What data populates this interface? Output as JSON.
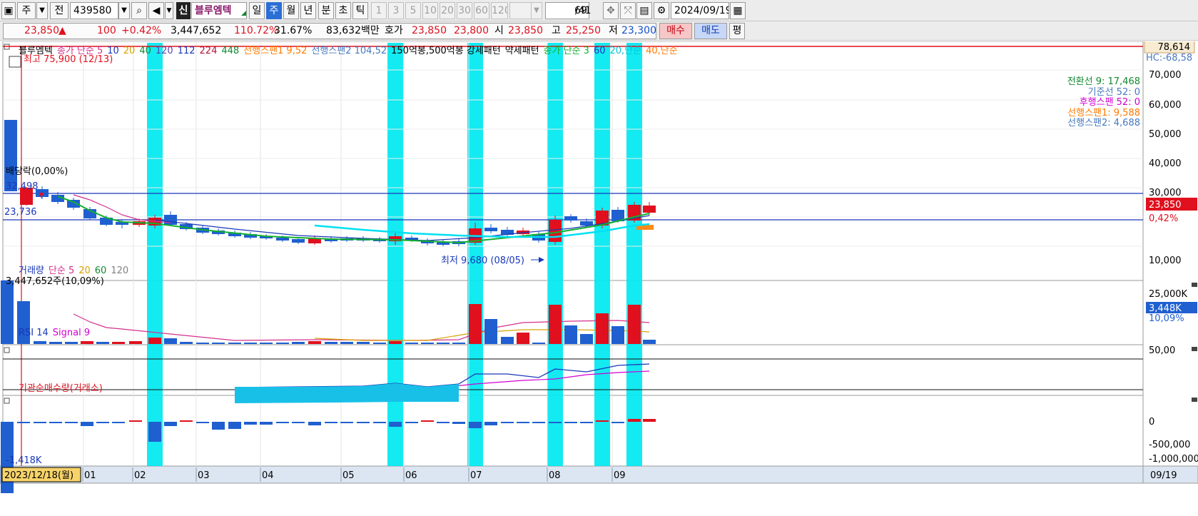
{
  "toolbar": {
    "period_unit": "주",
    "prev_label": "전",
    "code": "439580",
    "badge": "신",
    "stock_name": "블루엠텍",
    "periods": [
      "일",
      "주",
      "월",
      "년",
      "분",
      "초",
      "틱"
    ],
    "selected_period": "주",
    "intervals": [
      "1",
      "3",
      "5",
      "10",
      "20",
      "30",
      "60",
      "120"
    ],
    "count": "69",
    "count_total": "/41",
    "date": "2024/09/19"
  },
  "quote": {
    "price": "23,850",
    "arrow": "▲",
    "change": "100",
    "change_pct": "+0.42%",
    "volume": "3,447,652",
    "vol_ratio": "110.72%",
    "turnover": "31.67%",
    "amount": "83,632백만",
    "bid_ask_label": "호가",
    "ask": "23,850",
    "bid": "23,800",
    "open_label": "시",
    "open": "23,850",
    "high_label": "고",
    "high": "25,250",
    "low_label": "저",
    "low": "23,300",
    "buy_label": "매수",
    "sell_label": "매도",
    "eval_label": "평"
  },
  "price_panel": {
    "legend": [
      {
        "text": "블루엠텍",
        "color": "#000000"
      },
      {
        "text": "종가 단순 5",
        "color": "#d2308e"
      },
      {
        "text": "10",
        "color": "#1a38b8"
      },
      {
        "text": "20",
        "color": "#d9a200"
      },
      {
        "text": "40",
        "color": "#12882e"
      },
      {
        "text": "120",
        "color": "#5d3fb0"
      },
      {
        "text": "112",
        "color": "#1a38b8"
      },
      {
        "text": "224",
        "color": "#b01838"
      },
      {
        "text": "448",
        "color": "#12882e"
      },
      {
        "text": "선행스팬1 9,52",
        "color": "#ff7a00"
      },
      {
        "text": "선행스팬2 104,52",
        "color": "#4678c0"
      },
      {
        "text": "150억봉,500억봉 강세패턴",
        "color": "#000000"
      },
      {
        "text": "약세패턴",
        "color": "#000000"
      },
      {
        "text": "종가 단순 3",
        "color": "#12b02e"
      },
      {
        "text": "60",
        "color": "#1a38b8"
      },
      {
        "text": "20,단순",
        "color": "#00c8dc"
      },
      {
        "text": "40,단순",
        "color": "#ff7a00"
      }
    ],
    "high_note": "최고 75,900 (12/13)",
    "low_note": "최저 9,680 (08/05)",
    "dividend_note": "배당락(0,00%)",
    "level_upper": "32,498",
    "level_lower": "23,736",
    "top_value": "78,614",
    "hc_value": "HC:-68,58",
    "y_ticks": [
      "70,000",
      "60,000",
      "50,000",
      "40,000",
      "30,000",
      "10,000"
    ],
    "price_tag": "23,850",
    "price_tag_pct": "0,42%",
    "ichimoku": [
      {
        "text": "전환선 9: 17,468",
        "color": "#12882e"
      },
      {
        "text": "기준선 52: 0",
        "color": "#4678c0"
      },
      {
        "text": "후행스팬 52: 0",
        "color": "#d200d2"
      },
      {
        "text": "선행스팬1: 9,588",
        "color": "#ff7a00"
      },
      {
        "text": "선행스팬2: 4,688",
        "color": "#4678c0"
      }
    ]
  },
  "volume_panel": {
    "legend": [
      {
        "text": "거래량",
        "color": "#1a38b8"
      },
      {
        "text": "단순 5",
        "color": "#d2308e"
      },
      {
        "text": "20",
        "color": "#d9a200"
      },
      {
        "text": "60",
        "color": "#12882e"
      },
      {
        "text": "120",
        "color": "#808080"
      }
    ],
    "current": "3,447,652주(10,09%)",
    "y_tick": "25,000K",
    "tag": "3,448K",
    "tag_pct": "10,09%"
  },
  "rsi_panel": {
    "legend": [
      {
        "text": "RSI 14",
        "color": "#1a38b8"
      },
      {
        "text": "Signal 9",
        "color": "#d200d2"
      }
    ],
    "y_tick": "50,00"
  },
  "inst_panel": {
    "legend": [
      {
        "text": "기관순매수량(거래소)",
        "color": "#e0101e"
      }
    ],
    "y_ticks": [
      "0",
      "-500,000",
      "-1,000,000"
    ],
    "min_label": "-1,418K"
  },
  "x_axis": {
    "cursor_date": "2023/12/18(월)",
    "months": [
      "01",
      "02",
      "03",
      "04",
      "05",
      "06",
      "07",
      "08",
      "09"
    ],
    "end_label": "09/19"
  },
  "colors": {
    "up": "#e0101e",
    "down": "#1f5fd0",
    "highlight": "#00e8f0",
    "axis_bg": "#dce6f2"
  }
}
